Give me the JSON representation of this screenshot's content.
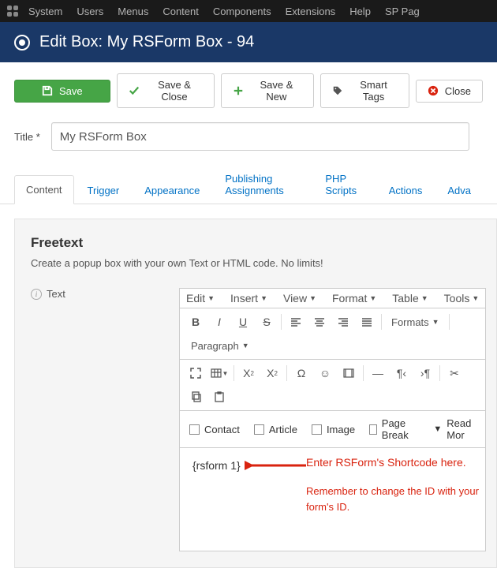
{
  "adminMenu": [
    "System",
    "Users",
    "Menus",
    "Content",
    "Components",
    "Extensions",
    "Help",
    "SP Pag"
  ],
  "pageTitle": "Edit Box: My RSForm Box - 94",
  "toolbar": {
    "save": "Save",
    "saveClose": "Save & Close",
    "saveNew": "Save & New",
    "smartTags": "Smart Tags",
    "close": "Close"
  },
  "titleField": {
    "label": "Title *",
    "value": "My RSForm Box"
  },
  "tabs": [
    "Content",
    "Trigger",
    "Appearance",
    "Publishing Assignments",
    "PHP Scripts",
    "Actions",
    "Adva"
  ],
  "activeTab": 0,
  "panel": {
    "heading": "Freetext",
    "description": "Create a popup box with your own Text or HTML code. No limits!",
    "fieldLabel": "Text"
  },
  "editor": {
    "menus": [
      "Edit",
      "Insert",
      "View",
      "Format",
      "Table",
      "Tools"
    ],
    "formatsLabel": "Formats",
    "paragraphLabel": "Paragraph",
    "bottomActions": {
      "contact": "Contact",
      "article": "Article",
      "image": "Image",
      "pageBreak": "Page Break",
      "readMore": "Read Mor"
    },
    "content": "{rsform 1}"
  },
  "annotation": {
    "line1": "Enter RSForm's Shortcode here.",
    "line2": "Remember to change the ID with your form's ID."
  }
}
